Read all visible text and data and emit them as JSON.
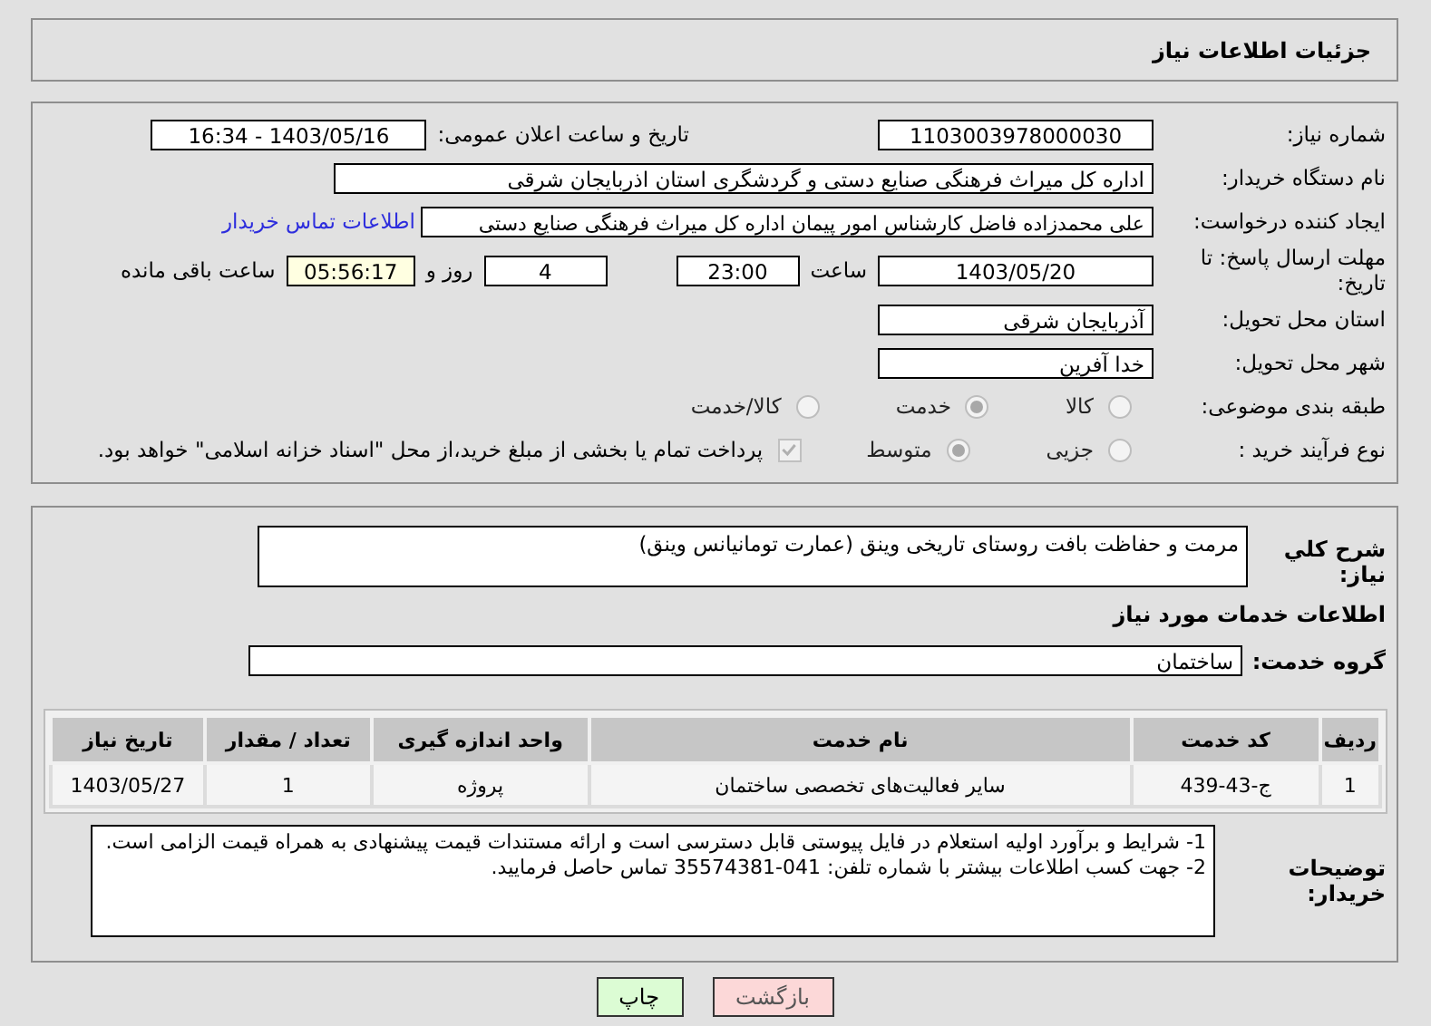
{
  "header": {
    "title": "جزئیات اطلاعات نیاز"
  },
  "need_number": {
    "label": "شماره نیاز:",
    "value": "1103003978000030"
  },
  "announce": {
    "label": "تاریخ و ساعت اعلان عمومی:",
    "value": "1403/05/16 - 16:34"
  },
  "buyer": {
    "label": "نام دستگاه خریدار:",
    "value": "اداره کل میراث فرهنگی  صنایع دستی و گردشگری استان اذربایجان شرقی"
  },
  "creator": {
    "label": "ایجاد کننده درخواست:",
    "value": "علی محمدزاده فاضل کارشناس امور پیمان اداره کل میراث فرهنگی  صنایع دستی",
    "link": "اطلاعات تماس خریدار"
  },
  "deadline": {
    "label": "مهلت ارسال پاسخ: تا تاریخ:",
    "date": "1403/05/20",
    "time_label": "ساعت",
    "time": "23:00",
    "days": "4",
    "days_label": "روز و",
    "remaining": "05:56:17",
    "remaining_label": "ساعت باقی مانده"
  },
  "province": {
    "label": "استان محل تحویل:",
    "value": "آذربایجان شرقی"
  },
  "city": {
    "label": "شهر محل تحویل:",
    "value": "خدا آفرین"
  },
  "category": {
    "label": "طبقه بندی موضوعی:",
    "options": [
      {
        "label": "کالا",
        "selected": false
      },
      {
        "label": "خدمت",
        "selected": true
      },
      {
        "label": "کالا/خدمت",
        "selected": false
      }
    ]
  },
  "process": {
    "label": "نوع فرآیند خرید :",
    "options": [
      {
        "label": "جزیی",
        "selected": false
      },
      {
        "label": "متوسط",
        "selected": true
      }
    ],
    "payment": {
      "checked": true,
      "text": "پرداخت تمام یا بخشی از مبلغ خرید،از محل \"اسناد خزانه اسلامی\" خواهد بود."
    }
  },
  "description": {
    "label": "شرح کلي نياز:",
    "value": "مرمت و حفاظت بافت روستای تاریخی وینق (عمارت تومانیانس وینق)"
  },
  "services_heading": "اطلاعات خدمات مورد نیاز",
  "service_group": {
    "label": "گروه خدمت:",
    "value": "ساختمان"
  },
  "table": {
    "columns": [
      "ردیف",
      "کد خدمت",
      "نام خدمت",
      "واحد اندازه گیری",
      "تعداد / مقدار",
      "تاریخ نیاز"
    ],
    "rows": [
      [
        "1",
        "ج-43-439",
        "سایر فعالیت‌های تخصصی ساختمان",
        "پروژه",
        "1",
        "1403/05/27"
      ]
    ]
  },
  "notes": {
    "label": "توضیحات خریدار:",
    "lines": [
      "1- شرایط و برآورد اولیه استعلام در فایل پیوستی قابل دسترسی است و ارائه مستندات قیمت پیشنهادی به همراه قیمت الزامی است.",
      "2- جهت کسب اطلاعات بیشتر  با شماره تلفن: 041-35574381  تماس حاصل فرمایید."
    ]
  },
  "buttons": [
    {
      "label": "بازگشت",
      "kind": "back"
    },
    {
      "label": "چاپ",
      "kind": "print"
    }
  ]
}
